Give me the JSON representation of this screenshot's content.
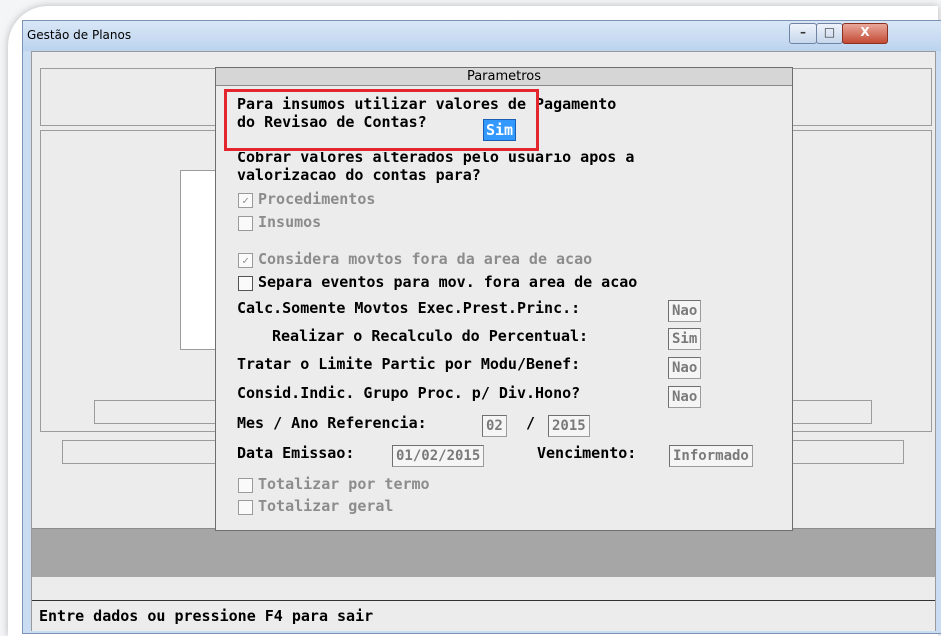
{
  "window": {
    "title": "Gestão de Planos",
    "minimize": "–",
    "maximize": "□",
    "close": "X"
  },
  "dialog": {
    "title": "Parametros",
    "q1_line1": "Para insumos utilizar valores de Pagamento",
    "q1_line2": "do Revisao de Contas?",
    "q1_value": "Sim",
    "q2_line1": "Cobrar valores alterados pelo usuario apos a",
    "q2_line2": "valorizacao do contas para?",
    "cb_procedimentos": {
      "label": "Procedimentos",
      "checked": true
    },
    "cb_insumos": {
      "label": "Insumos",
      "checked": false
    },
    "cb_considera": {
      "label": "Considera movtos fora da area de acao",
      "checked": true
    },
    "cb_separa": {
      "label": "Separa eventos para mov. fora area de acao",
      "checked": false
    },
    "calc_label": "Calc.Somente Movtos Exec.Prest.Princ.:",
    "calc_value": "Nao",
    "recalc_label": "Realizar o Recalculo do Percentual:",
    "recalc_value": "Sim",
    "limite_label": "Tratar o Limite Partic por Modu/Benef:",
    "limite_value": "Nao",
    "consid_label": "Consid.Indic. Grupo Proc. p/ Div.Hono?",
    "consid_value": "Nao",
    "mes_label": "Mes / Ano Referencia:",
    "mes_value": "02",
    "slash": "/",
    "ano_value": "2015",
    "data_label": "Data Emissao:",
    "data_value": "01/02/2015",
    "venc_label": "Vencimento:",
    "venc_value": "Informado",
    "cb_termo": {
      "label": "Totalizar por termo",
      "checked": false
    },
    "cb_geral": {
      "label": "Totalizar geral",
      "checked": false
    }
  },
  "status_text": "Entre dados ou pressione F4 para sair",
  "colors": {
    "highlight": "#e3262e",
    "selection": "#3399ff"
  }
}
